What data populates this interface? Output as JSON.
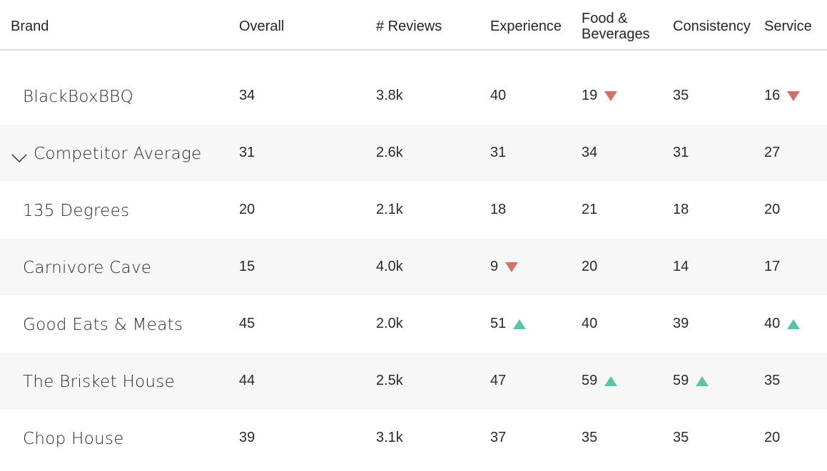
{
  "colors": {
    "down_arrow": "#d46f6c",
    "up_arrow": "#5cc2ae",
    "shaded_row": "#f7f7f7",
    "header_divider": "#dcdcdc"
  },
  "columns": {
    "brand": "Brand",
    "overall": "Overall",
    "reviews": "# Reviews",
    "experience": "Experience",
    "food_line1": "Food &",
    "food_line2": "Beverages",
    "consistency": "Consistency",
    "service": "Service"
  },
  "rows": [
    {
      "brand": "BlackBoxBBQ",
      "overall": "34",
      "reviews": "3.8k",
      "experience": "40",
      "food": "19",
      "consistency": "35",
      "service": "16",
      "trend": {
        "experience": "",
        "food": "down",
        "consistency": "",
        "service": "down"
      }
    },
    {
      "brand": "Competitor Average",
      "overall": "31",
      "reviews": "2.6k",
      "experience": "31",
      "food": "34",
      "consistency": "31",
      "service": "27",
      "expanded": true,
      "trend": {
        "experience": "",
        "food": "",
        "consistency": "",
        "service": ""
      }
    },
    {
      "brand": "135 Degrees",
      "overall": "20",
      "reviews": "2.1k",
      "experience": "18",
      "food": "21",
      "consistency": "18",
      "service": "20",
      "trend": {
        "experience": "",
        "food": "",
        "consistency": "",
        "service": ""
      }
    },
    {
      "brand": "Carnivore Cave",
      "overall": "15",
      "reviews": "4.0k",
      "experience": "9",
      "food": "20",
      "consistency": "14",
      "service": "17",
      "trend": {
        "experience": "down",
        "food": "",
        "consistency": "",
        "service": ""
      }
    },
    {
      "brand": "Good Eats & Meats",
      "overall": "45",
      "reviews": "2.0k",
      "experience": "51",
      "food": "40",
      "consistency": "39",
      "service": "40",
      "trend": {
        "experience": "up",
        "food": "",
        "consistency": "",
        "service": "up"
      }
    },
    {
      "brand": "The Brisket House",
      "overall": "44",
      "reviews": "2.5k",
      "experience": "47",
      "food": "59",
      "consistency": "59",
      "service": "35",
      "trend": {
        "experience": "",
        "food": "up",
        "consistency": "up",
        "service": ""
      }
    },
    {
      "brand": "Chop House",
      "overall": "39",
      "reviews": "3.1k",
      "experience": "37",
      "food": "35",
      "consistency": "35",
      "service": "20",
      "trend": {
        "experience": "",
        "food": "",
        "consistency": "",
        "service": ""
      }
    }
  ]
}
